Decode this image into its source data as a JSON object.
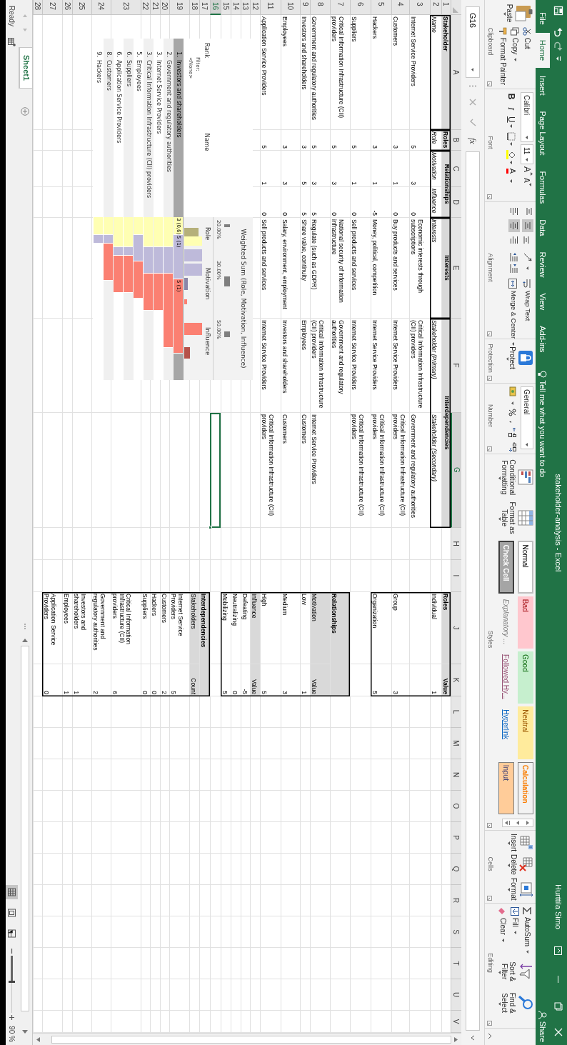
{
  "window": {
    "title": "stakeholder-analysis - Excel",
    "user": "Hurttila Simo"
  },
  "tabs": [
    {
      "label": "File",
      "selected": false
    },
    {
      "label": "Home",
      "selected": true
    },
    {
      "label": "Insert",
      "selected": false
    },
    {
      "label": "Page Layout",
      "selected": false
    },
    {
      "label": "Formulas",
      "selected": false
    },
    {
      "label": "Data",
      "selected": false
    },
    {
      "label": "Review",
      "selected": false
    },
    {
      "label": "View",
      "selected": false
    },
    {
      "label": "Add-ins",
      "selected": false
    }
  ],
  "tell_me": "Tell me what you want to do",
  "share": "Share",
  "clipboard": {
    "paste": "Paste",
    "cut": "Cut",
    "copy": "Copy",
    "format_painter": "Format Painter",
    "label": "Clipboard"
  },
  "font": {
    "name": "Calibri",
    "size": "11",
    "grow": "A",
    "shrink": "A",
    "bold": "B",
    "italic": "I",
    "underline": "U",
    "font_color": "A",
    "label": "Font"
  },
  "alignment": {
    "vertical": [
      {
        "selected": false
      },
      {
        "selected": true
      },
      {
        "selected": false
      }
    ],
    "horizontal": [
      {
        "selected": false
      },
      {
        "selected": true
      },
      {
        "selected": false
      }
    ],
    "wrap_text": "Wrap Text",
    "merge_center": "Merge & Center",
    "label": "Alignment"
  },
  "protection": {
    "protect": "Protect",
    "label": "Protection"
  },
  "number": {
    "format": "General",
    "label": "Number"
  },
  "styles": {
    "conditional_formatting": "Conditional Formatting",
    "format_as_table": "Format as Table",
    "gallery": [
      {
        "label": "Normal",
        "kind": "normal"
      },
      {
        "label": "Bad",
        "kind": "bad"
      },
      {
        "label": "Good",
        "kind": "good"
      },
      {
        "label": "Neutral",
        "kind": "neutral"
      },
      {
        "label": "Calculation",
        "kind": "calculation"
      },
      {
        "label": "Check Cell",
        "kind": "check"
      },
      {
        "label": "Explanatory ...",
        "kind": "explanatory"
      },
      {
        "label": "Followed Hy...",
        "kind": "followed"
      },
      {
        "label": "Hyperlink",
        "kind": "hyperlink"
      },
      {
        "label": "Input",
        "kind": "input"
      }
    ],
    "label": "Styles"
  },
  "cells": {
    "insert": "Insert",
    "delete": "Delete",
    "format": "Format",
    "label": "Cells"
  },
  "editing": {
    "autosum": "AutoSum",
    "fill": "Fill",
    "clear": "Clear",
    "sort_filter": "Sort & Filter",
    "find_select": "Find & Select",
    "label": "Editing"
  },
  "formula_bar": {
    "name_box": "G16",
    "function": "fx"
  },
  "columns": [
    {
      "label": "A",
      "selected": false
    },
    {
      "label": "B",
      "selected": false
    },
    {
      "label": "C",
      "selected": false
    },
    {
      "label": "D",
      "selected": false
    },
    {
      "label": "E",
      "selected": false
    },
    {
      "label": "F",
      "selected": false
    },
    {
      "label": "G",
      "selected": true
    },
    {
      "label": "H",
      "selected": false
    },
    {
      "label": "I",
      "selected": false
    },
    {
      "label": "J",
      "selected": false
    },
    {
      "label": "K",
      "selected": false
    },
    {
      "label": "L",
      "selected": false
    },
    {
      "label": "M",
      "selected": false
    },
    {
      "label": "N",
      "selected": false
    },
    {
      "label": "O",
      "selected": false
    },
    {
      "label": "P",
      "selected": false
    },
    {
      "label": "Q",
      "selected": false
    },
    {
      "label": "R",
      "selected": false
    },
    {
      "label": "S",
      "selected": false
    },
    {
      "label": "T",
      "selected": false
    },
    {
      "label": "U",
      "selected": false
    },
    {
      "label": "V",
      "selected": false
    }
  ],
  "rows": [
    {
      "label": "1",
      "selected": false
    },
    {
      "label": "2",
      "selected": false
    },
    {
      "label": "3",
      "selected": false
    },
    {
      "label": "4",
      "selected": false
    },
    {
      "label": "5",
      "selected": false
    },
    {
      "label": "6",
      "selected": false
    },
    {
      "label": "7",
      "selected": false
    },
    {
      "label": "8",
      "selected": false
    },
    {
      "label": "9",
      "selected": false
    },
    {
      "label": "10",
      "selected": false
    },
    {
      "label": "11",
      "selected": false
    },
    {
      "label": "12",
      "selected": false
    },
    {
      "label": "13",
      "selected": false
    },
    {
      "label": "14",
      "selected": false
    },
    {
      "label": "15",
      "selected": false
    },
    {
      "label": "16",
      "selected": true
    },
    {
      "label": "17",
      "selected": false
    },
    {
      "label": "18",
      "selected": false
    },
    {
      "label": "19",
      "selected": false
    },
    {
      "label": "20",
      "selected": false
    },
    {
      "label": "21",
      "selected": false
    },
    {
      "label": "22",
      "selected": false
    },
    {
      "label": "23",
      "selected": false
    },
    {
      "label": "24",
      "selected": false
    },
    {
      "label": "25",
      "selected": false
    },
    {
      "label": "26",
      "selected": false
    },
    {
      "label": "27",
      "selected": false
    },
    {
      "label": "28",
      "selected": false
    }
  ],
  "stakeholder_table": {
    "headings": [
      "Stakeholder",
      "Roles",
      "Relationships",
      "Interests",
      "Interdependencies"
    ],
    "columns": [
      "Name",
      "Role",
      "Motivation",
      "Influence",
      "Interests",
      "Stakeholder (Primary)",
      "Stakeholder (Secondary)"
    ],
    "rows": [
      {
        "name": "Internet Service Providers",
        "role": "5",
        "motivation": "3",
        "influence": "0",
        "interests": "Economic interests through subscriptions",
        "primary": "Critical Information Infrastructure (CII) providers",
        "secondary": "Government and regulatory authorities"
      },
      {
        "name": "Customers",
        "role": "3",
        "motivation": "1",
        "influence": "0",
        "interests": "Buy products and services",
        "primary": "Internet Service Providers",
        "secondary": "Critical Information Infrastructure (CII) providers"
      },
      {
        "name": "Hackers",
        "role": "3",
        "motivation": "1",
        "influence": "-5",
        "interests": "Money, political, competition",
        "primary": "Internet Service Providers",
        "secondary": "Critical Information Infrastructure (CII) providers"
      },
      {
        "name": "Suppliers",
        "role": "5",
        "motivation": "1",
        "influence": "0",
        "interests": "Sell products and services",
        "primary": "Internet Service Providers",
        "secondary": "Critical Information Infrastructure (CII) providers"
      },
      {
        "name": "Critical Information Infrastructure (CII) providers",
        "role": "5",
        "motivation": "3",
        "influence": "0",
        "interests": "National security of information infrastructure",
        "primary": "Government and regulatory authorities"
      },
      {
        "name": "Government and regulatory authorities",
        "role": "5",
        "motivation": "3",
        "influence": "5",
        "interests": "Regulate (such as GDPR)",
        "primary": "Critical Information Infrastructure (CII) providers",
        "secondary": "Internet Service Providers"
      },
      {
        "name": "Investors and shareholders",
        "role": "3",
        "motivation": "5",
        "influence": "5",
        "interests": "Share value, continuity",
        "primary": "Employees",
        "secondary": "Customers"
      },
      {
        "name": "Employees",
        "role": "3",
        "motivation": "3",
        "influence": "0",
        "interests": "Salary, environment, employment",
        "primary": "Investors and shareholders",
        "secondary": "Customers"
      },
      {
        "name": "Application Service Providers",
        "role": "5",
        "motivation": "1",
        "influence": "0",
        "interests": "Sell products and services",
        "primary": "Internet Service Providers",
        "secondary": "Critical Information Infrastructure (CII) providers"
      }
    ]
  },
  "roles_table": {
    "heading": "Roles",
    "value_heading": "Value",
    "rows": [
      {
        "label": "Individual",
        "value": "1"
      },
      {
        "label": "Group",
        "value": "3"
      },
      {
        "label": "Organization",
        "value": "5"
      }
    ]
  },
  "relationships_table": {
    "heading": "Relationships",
    "sections": [
      {
        "heading": "Motivation",
        "value_heading": "Value",
        "rows": [
          {
            "label": "Low",
            "value": "1"
          },
          {
            "label": "Medium",
            "value": "3"
          },
          {
            "label": "High",
            "value": "5"
          }
        ]
      },
      {
        "heading": "Influence",
        "value_heading": "Value",
        "rows": [
          {
            "label": "Defeating",
            "value": "-5"
          },
          {
            "label": "Neutralizing",
            "value": "0"
          },
          {
            "label": "Mobilizing",
            "value": "5"
          }
        ]
      }
    ]
  },
  "interdependencies_table": {
    "heading": "Interdependencies",
    "columns": [
      "Stakeholders",
      "Count"
    ],
    "rows": [
      {
        "label": "Internet Service Providers",
        "value": "5"
      },
      {
        "label": "Customers",
        "value": "2"
      },
      {
        "label": "Hackers",
        "value": "0"
      },
      {
        "label": "Suppliers",
        "value": "0"
      },
      {
        "label": "Critical Information Infrastructure (CII) providers",
        "value": "6"
      },
      {
        "label": "Government and regulatory authorities",
        "value": "2"
      },
      {
        "label": "Investors and shareholders",
        "value": "1"
      },
      {
        "label": "Employees",
        "value": "1"
      },
      {
        "label": "Application Service Providers",
        "value": "0"
      }
    ]
  },
  "weighted_sum_visual": {
    "title": "Weighted Sum (Role, Motivation, Influence)",
    "weights": [
      "20.00%",
      "30.00%",
      "50.00%"
    ],
    "rank_heading": "Rank",
    "name_heading": "Name",
    "filter_label": "Filter:",
    "filter_value": "<None>",
    "measure_headings": [
      "Role",
      "Motivation",
      "Influence"
    ],
    "items": [
      {
        "rank": "1.",
        "name": "Investors and shareholders",
        "selected": true,
        "value_labels": [
          "3 (0,6)",
          "5 (1)",
          "5 (1)"
        ]
      },
      {
        "rank": "2.",
        "name": "Government and regulatory authorities",
        "selected": false
      },
      {
        "rank": "3.",
        "name": "Internet Service Providers",
        "selected": false
      },
      {
        "rank": "3.",
        "name": "Critical Information Infrastructure (CII) providers",
        "selected": false
      },
      {
        "rank": "5.",
        "name": "Employees",
        "selected": false
      },
      {
        "rank": "6.",
        "name": "Suppliers",
        "selected": false
      },
      {
        "rank": "6.",
        "name": "Application Service Providers",
        "selected": false
      },
      {
        "rank": "8.",
        "name": "Customers",
        "selected": false
      },
      {
        "rank": "9.",
        "name": "Hackers",
        "selected": false
      }
    ]
  },
  "sheet_tabs": [
    {
      "label": "Sheet1",
      "selected": true
    }
  ],
  "status_bar": {
    "status": "Ready",
    "view_buttons": [
      {
        "selected": true
      },
      {
        "selected": false
      },
      {
        "selected": false
      }
    ],
    "zoom_slider": {
      "level": 0.45
    },
    "zoom": "90 %"
  }
}
